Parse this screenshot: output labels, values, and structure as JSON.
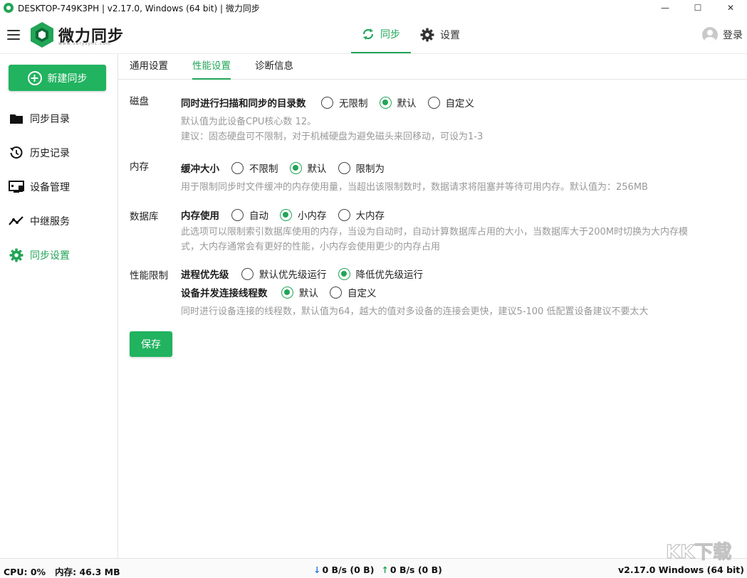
{
  "window": {
    "title": "DESKTOP-749K3PH | v2.17.0, Windows (64 bit) | 微力同步",
    "minimize": "—",
    "maximize": "☐",
    "close": "✕"
  },
  "header": {
    "brand": "微力同步",
    "brand_sub": "www.verysync.com",
    "nav": [
      {
        "label": "同步",
        "icon": "sync-icon",
        "active": true
      },
      {
        "label": "设置",
        "icon": "gear-icon",
        "active": false
      }
    ],
    "login": "登录"
  },
  "sidebar": {
    "new_sync": "新建同步",
    "items": [
      {
        "label": "同步目录",
        "icon": "folder-icon"
      },
      {
        "label": "历史记录",
        "icon": "history-icon"
      },
      {
        "label": "设备管理",
        "icon": "device-icon"
      },
      {
        "label": "中继服务",
        "icon": "relay-icon"
      },
      {
        "label": "同步设置",
        "icon": "gear-icon",
        "active": true
      }
    ]
  },
  "subtabs": [
    {
      "label": "通用设置",
      "active": false
    },
    {
      "label": "性能设置",
      "active": true
    },
    {
      "label": "诊断信息",
      "active": false
    }
  ],
  "sections": {
    "disk": {
      "label": "磁盘",
      "option": "同时进行扫描和同步的目录数",
      "choices": [
        "无限制",
        "默认",
        "自定义"
      ],
      "selected": "默认",
      "hint1": "默认值为此设备CPU核心数 12。",
      "hint2": "建议：固态硬盘可不限制，对于机械硬盘为避免磁头来回移动，可设为1-3"
    },
    "memory": {
      "label": "内存",
      "option": "缓冲大小",
      "choices": [
        "不限制",
        "默认",
        "限制为"
      ],
      "selected": "默认",
      "hint": "用于限制同步时文件缓冲的内存使用量，当超出该限制数时，数据请求将阻塞并等待可用内存。默认值为：256MB"
    },
    "database": {
      "label": "数据库",
      "option": "内存使用",
      "choices": [
        "自动",
        "小内存",
        "大内存"
      ],
      "selected": "小内存",
      "hint1": "此选项可以限制索引数据库使用的内存，当设为自动时，自动计算数据库占用的大小，当数据库大于200M时切换为大内存模",
      "hint2": "式，大内存通常会有更好的性能，小内存会使用更少的内存占用"
    },
    "perf": {
      "label": "性能限制",
      "priority_option": "进程优先级",
      "priority_choices": [
        "默认优先级运行",
        "降低优先级运行"
      ],
      "priority_selected": "降低优先级运行",
      "threads_option": "设备并发连接线程数",
      "threads_choices": [
        "默认",
        "自定义"
      ],
      "threads_selected": "默认",
      "hint": "同时进行设备连接的线程数，默认值为64，越大的值对多设备的连接会更快，建议5-100 低配置设备建议不要太大"
    }
  },
  "save": "保存",
  "status": {
    "cpu": "CPU: 0%",
    "mem": "内存: 46.3 MB",
    "down": "0 B/s (0 B)",
    "up": "0 B/s (0 B)",
    "version": "v2.17.0  Windows (64 bit)"
  },
  "watermark": "KK下载",
  "colors": {
    "accent": "#21a557",
    "button": "#21b35f",
    "hint": "#999999"
  }
}
